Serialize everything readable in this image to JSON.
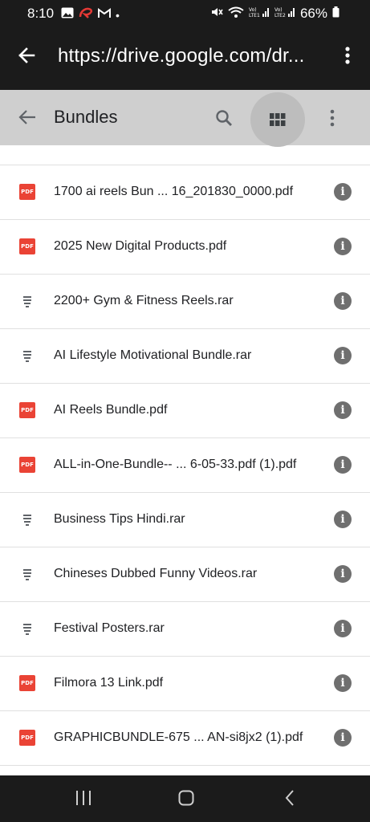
{
  "status_bar": {
    "time": "8:10",
    "dot": "•",
    "battery": "66%"
  },
  "browser": {
    "url": "https://drive.google.com/dr..."
  },
  "appbar": {
    "title": "Bundles"
  },
  "files": [
    {
      "name": "1700 ai reels Bun ... 16_201830_0000.pdf",
      "type": "pdf"
    },
    {
      "name": "2025 New Digital Products.pdf",
      "type": "pdf"
    },
    {
      "name": "2200+ Gym & Fitness Reels.rar",
      "type": "archive"
    },
    {
      "name": "AI Lifestyle Motivational Bundle.rar",
      "type": "archive"
    },
    {
      "name": "AI Reels Bundle.pdf",
      "type": "pdf"
    },
    {
      "name": "ALL-in-One-Bundle-- ... 6-05-33.pdf (1).pdf",
      "type": "pdf"
    },
    {
      "name": "Business Tips Hindi.rar",
      "type": "archive"
    },
    {
      "name": "Chineses Dubbed Funny Videos.rar",
      "type": "archive"
    },
    {
      "name": "Festival Posters.rar",
      "type": "archive"
    },
    {
      "name": "Filmora 13 Link.pdf",
      "type": "pdf"
    },
    {
      "name": "GRAPHICBUNDLE-675 ... AN-si8jx2 (1).pdf",
      "type": "pdf"
    }
  ],
  "icons": {
    "pdf_label": "PDF",
    "info_glyph": "i"
  }
}
